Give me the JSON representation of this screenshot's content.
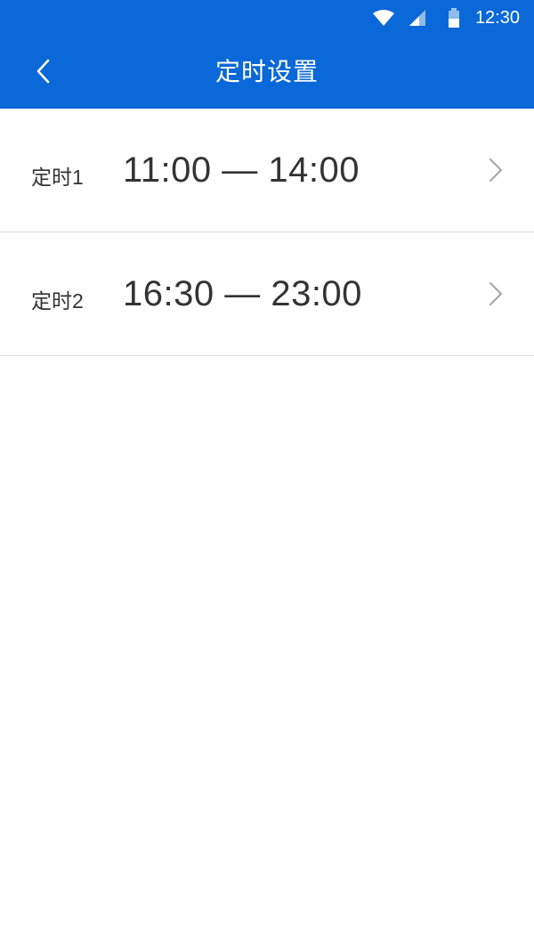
{
  "status": {
    "time": "12:30",
    "icons": [
      "wifi-icon",
      "signal-icon",
      "battery-icon"
    ]
  },
  "header": {
    "title": "定时设置",
    "back_icon": "back-chevron-icon",
    "background": "#0a68d8"
  },
  "timers": [
    {
      "label": "定时1",
      "time": "11:00 — 14:00",
      "icon": "chevron-right-icon"
    },
    {
      "label": "定时2",
      "time": "16:30 — 23:00",
      "icon": "chevron-right-icon"
    }
  ]
}
